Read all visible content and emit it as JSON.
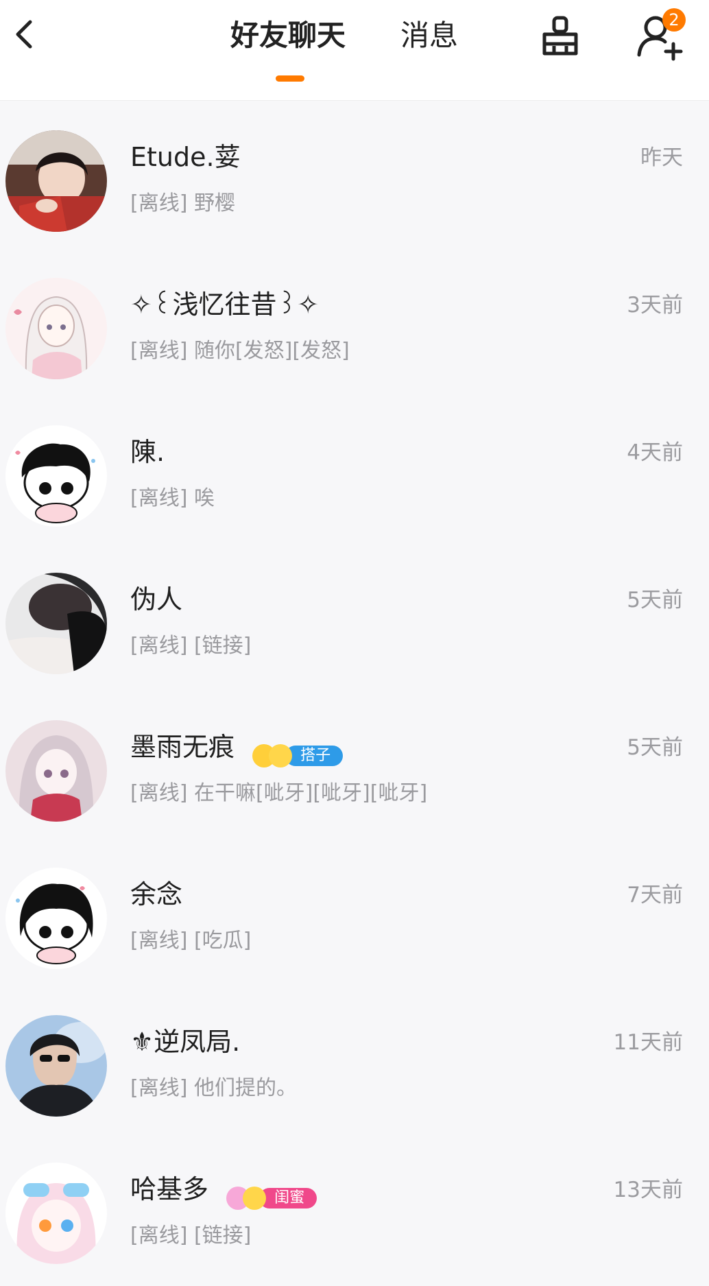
{
  "header": {
    "tabs": [
      {
        "label": "好友聊天",
        "active": true
      },
      {
        "label": "消息",
        "active": false
      }
    ],
    "friend_request_badge": "2",
    "accent_color": "#ff7a00"
  },
  "chats": [
    {
      "name": "Etude.荽",
      "time": "昨天",
      "preview": "[离线] 野樱",
      "avatar": "photo-girl-red-sweater"
    },
    {
      "name": "✧꒰浅忆往昔꒱✧",
      "time": "3天前",
      "preview": "[离线] 随你[发怒][发怒]",
      "avatar": "anime-girl-white-hair"
    },
    {
      "name": "陳.",
      "time": "4天前",
      "preview": "[离线] 唉",
      "avatar": "chibi-boy"
    },
    {
      "name": "伪人",
      "time": "5天前",
      "preview": "[离线] [链接]",
      "avatar": "photo-arm-dark"
    },
    {
      "name": "墨雨无痕",
      "time": "5天前",
      "preview": "[离线] 在干嘛[呲牙][呲牙][呲牙]",
      "avatar": "anime-girl-pink",
      "tag": "搭子",
      "tag_color": "#2e9be8"
    },
    {
      "name": "余念",
      "time": "7天前",
      "preview": "[离线] [吃瓜]",
      "avatar": "chibi-girl"
    },
    {
      "name": "⚜逆凤局.",
      "time": "11天前",
      "preview": "[离线] 他们提的。",
      "avatar": "photo-boy-sunglasses"
    },
    {
      "name": "哈基多",
      "time": "13天前",
      "preview": "[离线] [链接]",
      "avatar": "anime-girl-goggles",
      "tag": "闺蜜",
      "tag_color": "#f0488a"
    }
  ]
}
